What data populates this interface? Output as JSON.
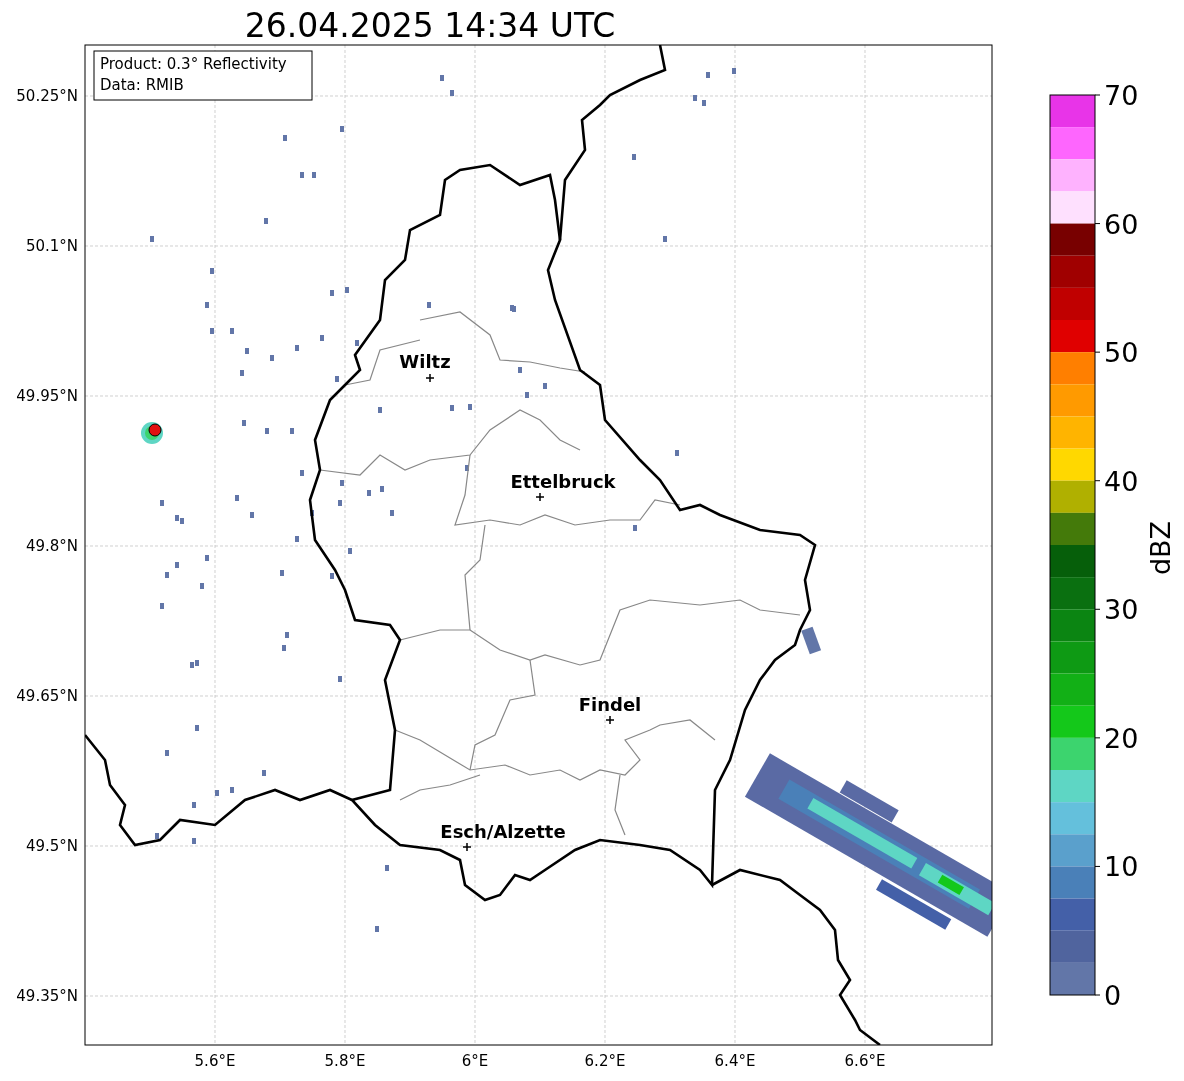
{
  "title": "26.04.2025 14:34 UTC",
  "info_box": [
    "Product: 0.3° Reflectivity",
    "Data: RMIB"
  ],
  "lat_labels": [
    "50.25°N",
    "50.1°N",
    "49.95°N",
    "49.8°N",
    "49.65°N",
    "49.5°N",
    "49.35°N"
  ],
  "lon_labels": [
    "5.6°E",
    "5.8°E",
    "6°E",
    "6.2°E",
    "6.4°E",
    "6.6°E"
  ],
  "cities": [
    {
      "name": "Wiltz"
    },
    {
      "name": "Ettelbruck"
    },
    {
      "name": "Findel"
    },
    {
      "name": "Esch/Alzette"
    }
  ],
  "colorbar": {
    "label": "dBZ",
    "ticks": [
      "70",
      "60",
      "50",
      "40",
      "30",
      "20",
      "10",
      "0"
    ],
    "segments": [
      {
        "color": "#e834e8"
      },
      {
        "color": "#fe66fe"
      },
      {
        "color": "#feb2fe"
      },
      {
        "color": "#fee0fe"
      },
      {
        "color": "#780000"
      },
      {
        "color": "#a00000"
      },
      {
        "color": "#c00000"
      },
      {
        "color": "#e00000"
      },
      {
        "color": "#ff7f00"
      },
      {
        "color": "#ff9a00"
      },
      {
        "color": "#ffb400"
      },
      {
        "color": "#ffd800"
      },
      {
        "color": "#b0b000"
      },
      {
        "color": "#447a0a"
      },
      {
        "color": "#065f0a"
      },
      {
        "color": "#0a7010"
      },
      {
        "color": "#0b8512"
      },
      {
        "color": "#0e9a14"
      },
      {
        "color": "#12b016"
      },
      {
        "color": "#14c81a"
      },
      {
        "color": "#3cd46e"
      },
      {
        "color": "#5ed6c4"
      },
      {
        "color": "#64c0dc"
      },
      {
        "color": "#5aa0cc"
      },
      {
        "color": "#4a80b8"
      },
      {
        "color": "#4460a8"
      },
      {
        "color": "#50649e"
      },
      {
        "color": "#6276a8"
      }
    ]
  }
}
